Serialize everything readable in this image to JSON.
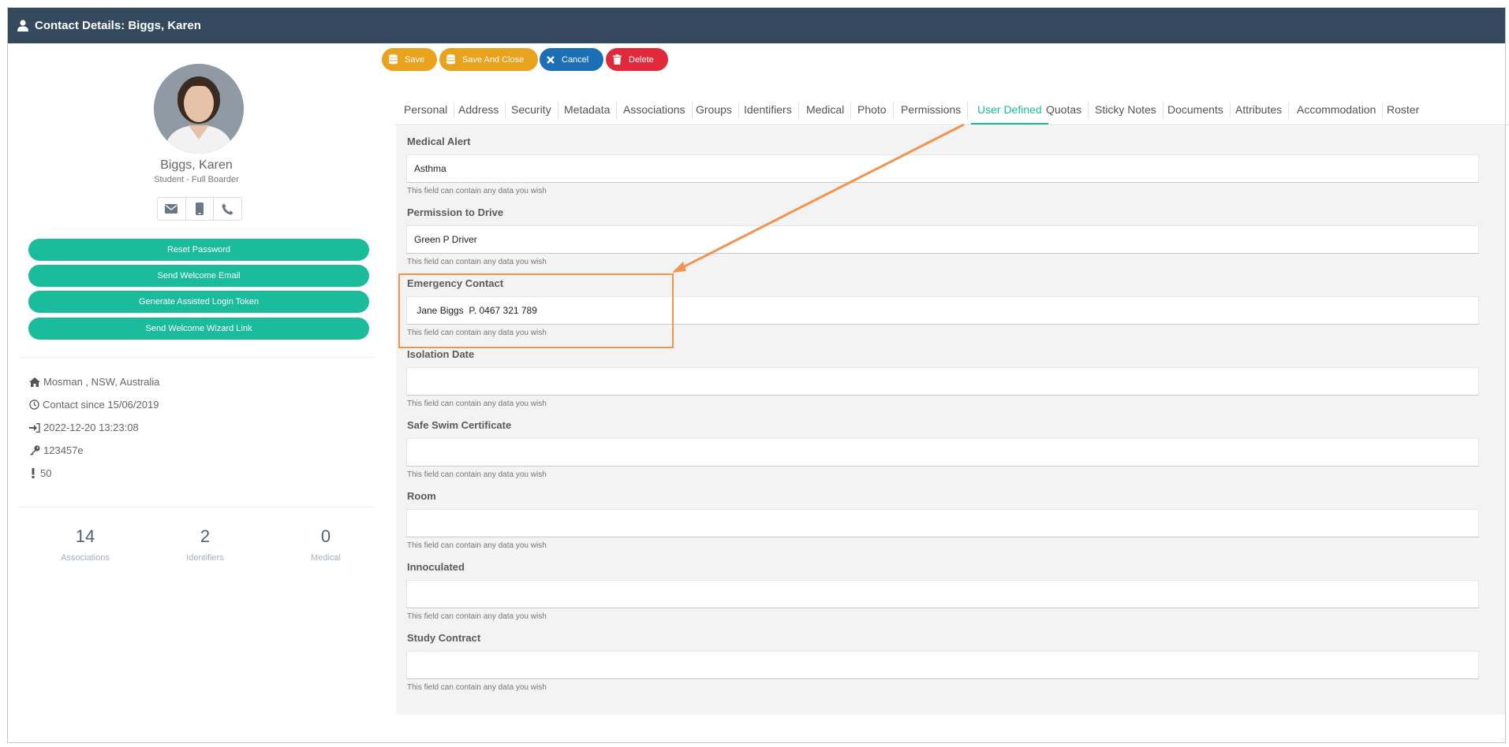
{
  "window": {
    "title": "Contact Details: Biggs, Karen",
    "icon": "user-icon"
  },
  "profile": {
    "name": "Biggs, Karen",
    "role": "Student - Full Boarder",
    "comm_icons": [
      "envelope-icon",
      "mobile-icon",
      "phone-icon"
    ]
  },
  "actions": [
    "Reset Password",
    "Send Welcome Email",
    "Generate Assisted Login Token",
    "Send Welcome Wizard Link"
  ],
  "info": {
    "location": "Mosman , NSW, Australia",
    "contact_since": "Contact since 15/06/2019",
    "last_login": "2022-12-20 13:23:08",
    "key": "123457e",
    "alert_count": "50"
  },
  "stats": [
    {
      "value": "14",
      "label": "Associations"
    },
    {
      "value": "2",
      "label": "Identifiers"
    },
    {
      "value": "0",
      "label": "Medical"
    }
  ],
  "toolbar": {
    "save": "Save",
    "save_close": "Save And Close",
    "cancel": "Cancel",
    "delete": "Delete"
  },
  "tabs": [
    "Personal",
    "Address",
    "Security",
    "Metadata",
    "Associations",
    "Groups",
    "Identifiers",
    "Medical",
    "Photo",
    "Permissions",
    "User Defined",
    "Quotas",
    "Sticky Notes",
    "Documents",
    "Attributes",
    "Accommodation",
    "Roster"
  ],
  "active_tab": "User Defined",
  "fields": [
    {
      "label": "Medical Alert",
      "value": "Asthma",
      "help": "This field can contain any data you wish"
    },
    {
      "label": "Permission to Drive",
      "value": "Green P Driver",
      "help": "This field can contain any data you wish"
    },
    {
      "label": "Emergency Contact",
      "value": " Jane Biggs  P. 0467 321 789",
      "help": "This field can contain any data you wish"
    },
    {
      "label": "Isolation Date",
      "value": "",
      "help": "This field can contain any data you wish"
    },
    {
      "label": "Safe Swim Certificate",
      "value": "",
      "help": "This field can contain any data you wish"
    },
    {
      "label": "Room",
      "value": "",
      "help": "This field can contain any data you wish"
    },
    {
      "label": "Innoculated",
      "value": "",
      "help": "This field can contain any data you wish"
    },
    {
      "label": "Study Contract",
      "value": "",
      "help": "This field can contain any data you wish"
    }
  ],
  "colors": {
    "header": "#34495e",
    "accent": "#1abc9c",
    "save": "#e8a21d",
    "cancel": "#1c6fb5",
    "delete": "#e02a3b",
    "annotation": "#f0944f"
  }
}
